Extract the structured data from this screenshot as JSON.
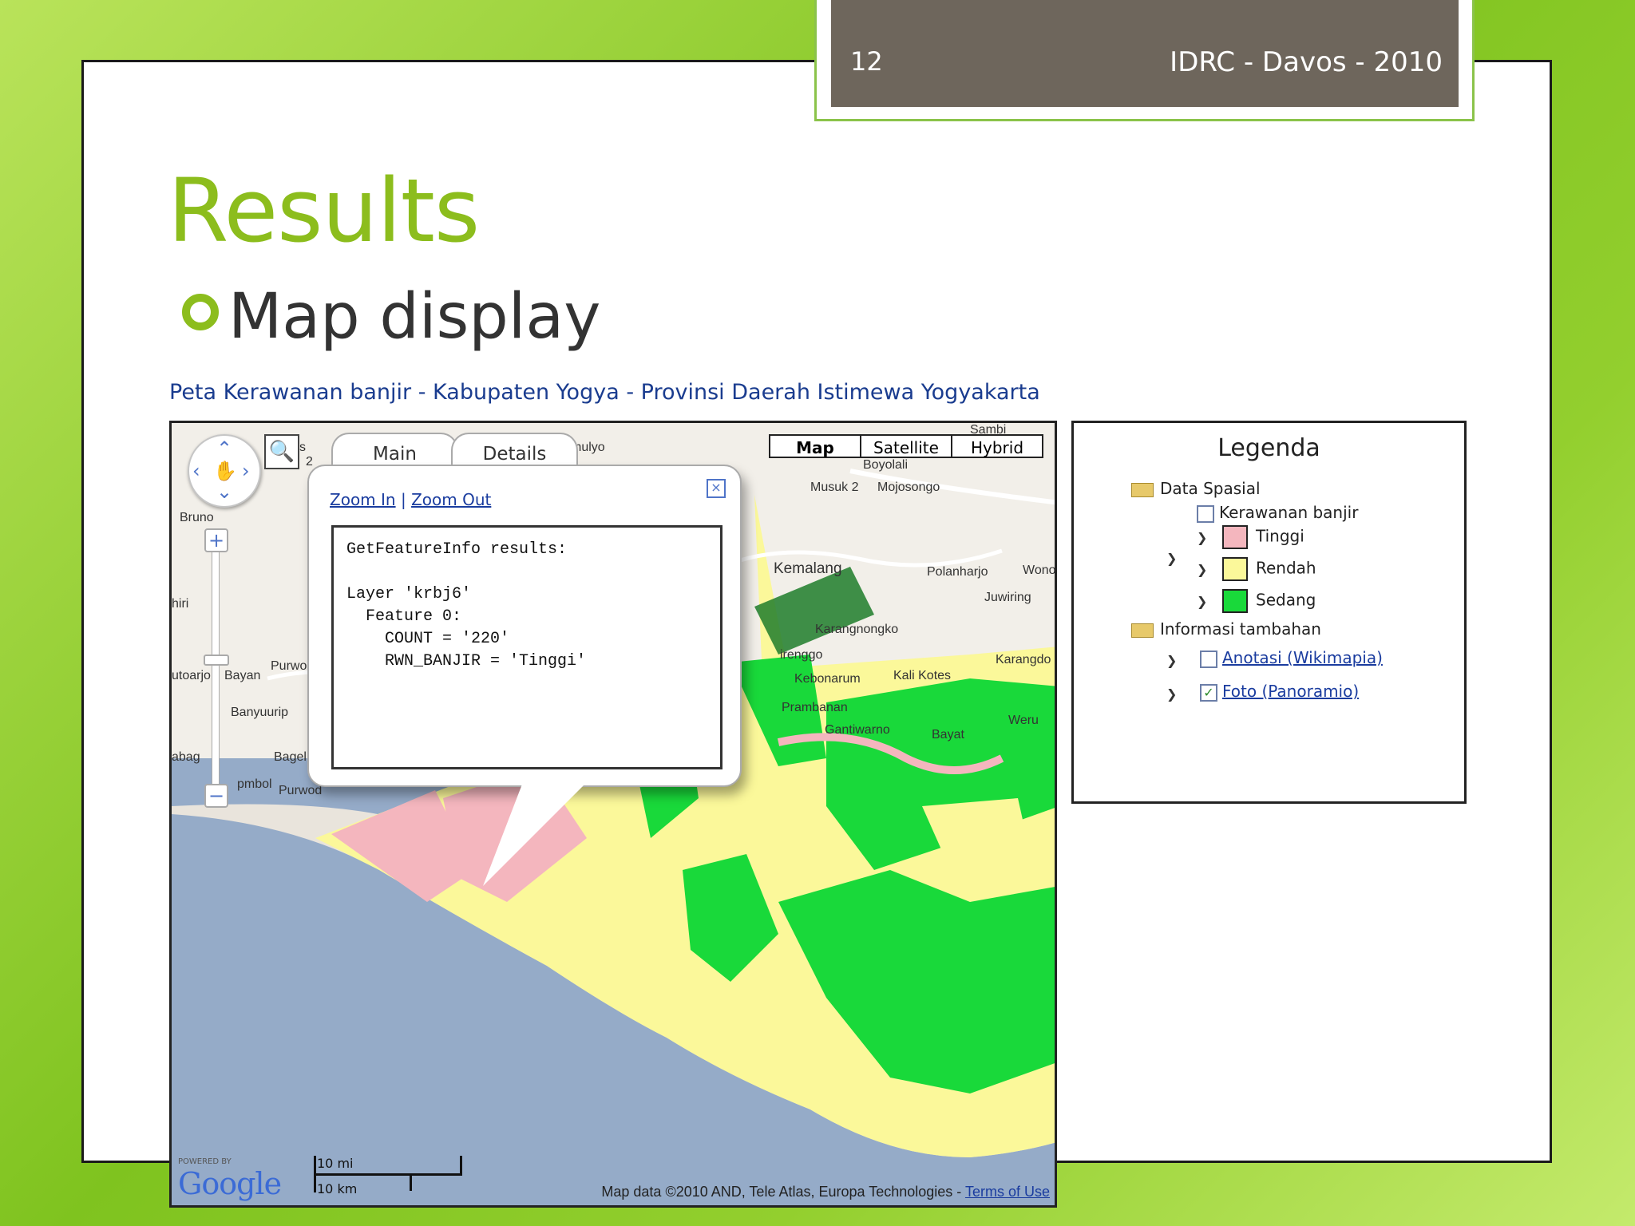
{
  "header": {
    "slide_number": "12",
    "event": "IDRC - Davos - 2010"
  },
  "slide": {
    "title": "Results",
    "bullet": "Map display"
  },
  "map": {
    "title": "Peta Kerawanan banjir - Kabupaten Yogya - Provinsi Daerah Istimewa Yogyakarta",
    "map_types": [
      "Map",
      "Satellite",
      "Hybrid"
    ],
    "place_labels": [
      "Sambi",
      "Boyolali",
      "Musuk 2",
      "Mojosongo",
      "Kemalang",
      "Polanharjo",
      "Wono",
      "Juwiring",
      "Karangnongko",
      "Karangdo",
      "Kebonarum",
      "Kali Kotes",
      "Prambanan",
      "Gantiwarno",
      "Weru",
      "Bayat",
      "Bruno",
      "Purwo",
      "Bayan",
      "Banyuurip",
      "Bagel",
      "Purwod",
      "mulyo",
      "irenggo",
      "abag",
      "utoarjo",
      "pmbol",
      "hiri",
      "2",
      "s"
    ],
    "popup": {
      "tabs": [
        "Main",
        "Details"
      ],
      "zoom_in": "Zoom In",
      "separator": "|",
      "zoom_out": "Zoom Out",
      "result_text": "GetFeatureInfo results:\n\nLayer 'krbj6'\n  Feature 0:\n    COUNT = '220'\n    RWN_BANJIR = 'Tinggi'"
    },
    "scale": {
      "miles": "10 mi",
      "km": "10 km"
    },
    "google": {
      "powered_by": "POWERED BY",
      "logo": "Google"
    },
    "copyright": "Map data ©2010 AND, Tele Atlas, Europa Technologies -",
    "terms_link": "Terms of Use"
  },
  "legend": {
    "title": "Legenda",
    "group1": "Data Spasial",
    "layer1": "Kerawanan banjir",
    "classes": [
      {
        "label": "Tinggi",
        "color": "#f4b6be"
      },
      {
        "label": "Rendah",
        "color": "#fbf89a"
      },
      {
        "label": "Sedang",
        "color": "#19d93a"
      }
    ],
    "group2": "Informasi tambahan",
    "extra": [
      {
        "label": "Anotasi (Wikimapia)",
        "checked": false
      },
      {
        "label": "Foto (Panoramio)",
        "checked": true
      }
    ]
  }
}
